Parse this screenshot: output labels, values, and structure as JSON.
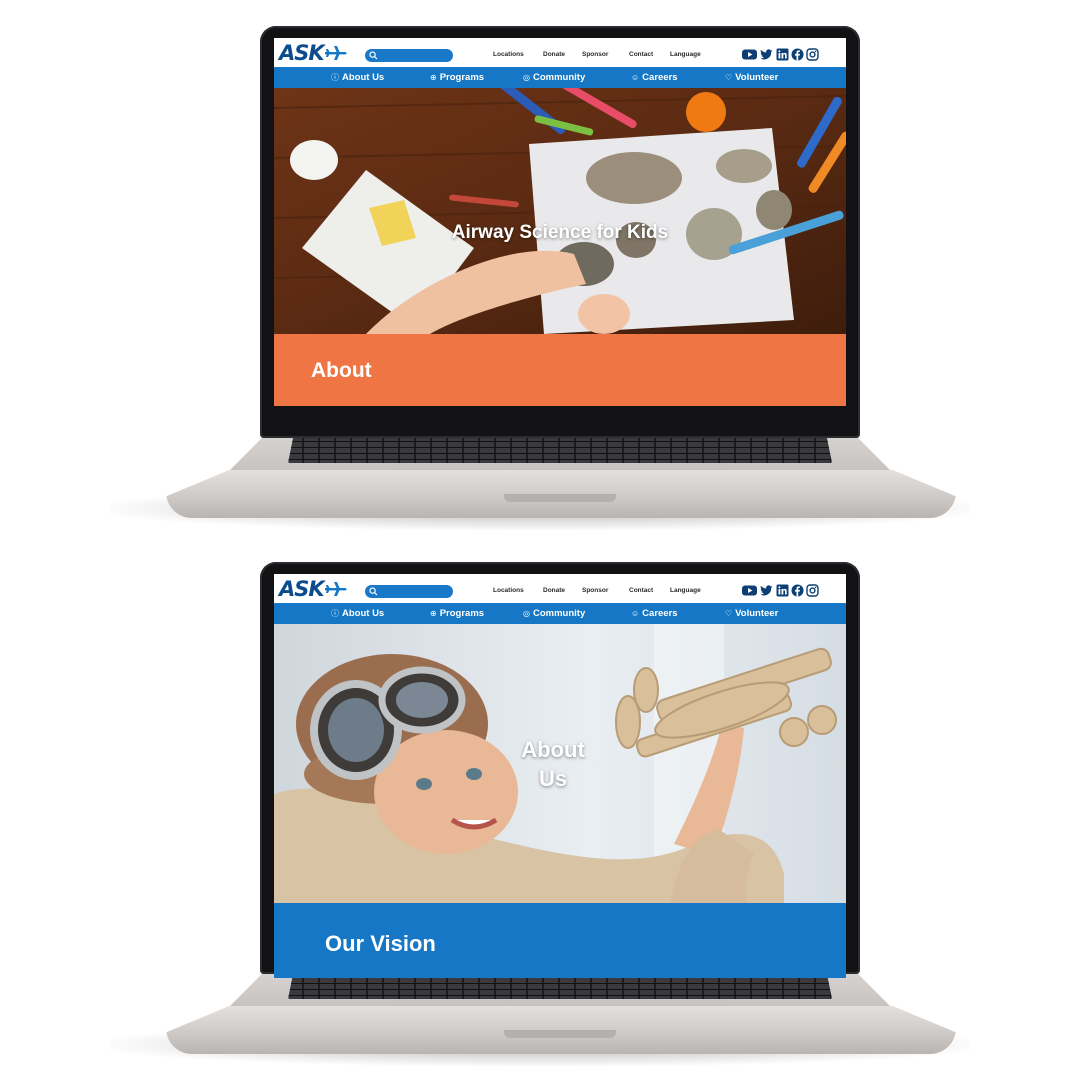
{
  "site": {
    "logo_text": "ASK",
    "search_placeholder": "",
    "top_links": [
      "Locations",
      "Donate",
      "Sponsor",
      "Contact",
      "Language"
    ],
    "social_icons": [
      "youtube-icon",
      "twitter-icon",
      "linkedin-icon",
      "facebook-icon",
      "instagram-icon"
    ],
    "nav": [
      {
        "label": "About Us",
        "icon": "info-icon"
      },
      {
        "label": "Programs",
        "icon": "globe-icon"
      },
      {
        "label": "Community",
        "icon": "people-icon"
      },
      {
        "label": "Careers",
        "icon": "smile-icon"
      },
      {
        "label": "Volunteer",
        "icon": "heart-icon"
      }
    ],
    "colors": {
      "brand_blue": "#1577c6",
      "logo_navy": "#0d4c8c",
      "accent_orange": "#ef7644"
    }
  },
  "screens": [
    {
      "hero_title": "Airway Science for Kids",
      "hero_image": "kids-crafting-table-photo",
      "band_title": "About",
      "band_color": "#ef7644"
    },
    {
      "hero_title": "About Us",
      "hero_image": "child-aviator-with-toy-plane-photo",
      "band_title": "Our Vision",
      "band_color": "#1577c6"
    }
  ]
}
